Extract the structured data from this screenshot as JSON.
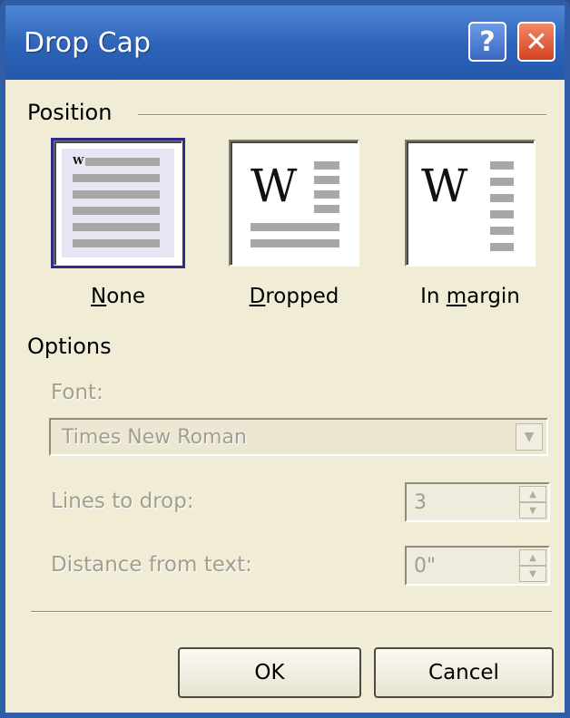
{
  "window": {
    "title": "Drop Cap",
    "help_label": "?",
    "close_label": "✕"
  },
  "position": {
    "group_label": "Position",
    "options": [
      {
        "label": "None",
        "mnemonic": "N",
        "rest": "one",
        "selected": true
      },
      {
        "label": "Dropped",
        "mnemonic": "D",
        "rest": "ropped",
        "selected": false
      },
      {
        "label": "In margin",
        "prefix": "In ",
        "mnemonic": "m",
        "rest": "argin",
        "selected": false
      }
    ],
    "preview_glyph": "W"
  },
  "options": {
    "group_label": "Options",
    "font_label": "Font:",
    "font_value": "Times New Roman",
    "lines_label": "Lines to drop:",
    "lines_value": "3",
    "distance_label": "Distance from text:",
    "distance_value": "0\""
  },
  "buttons": {
    "ok": "OK",
    "cancel": "Cancel"
  },
  "colors": {
    "titlebar": "#2c63b8",
    "dialog_bg": "#f1ecd6",
    "close_button": "#d3411f",
    "selected_outline": "#2f2a8e",
    "disabled_text": "#a29e8f"
  }
}
